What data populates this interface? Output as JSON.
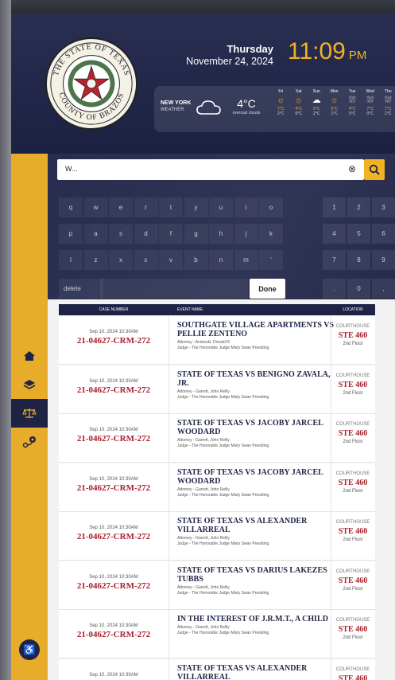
{
  "header": {
    "day": "Thursday",
    "date": "November 24, 2024",
    "time": "11:09",
    "ampm": "PM",
    "seal_text": "THE STATE OF TEXAS · COUNTY OF BRAZOS",
    "weather": {
      "city": "NEW YORK",
      "label": "WEATHER",
      "temp": "4°C",
      "desc": "overcast clouds",
      "forecast": [
        {
          "day": "Fri",
          "icon": "sun-icon",
          "hi": "7°C",
          "lo": "2°C"
        },
        {
          "day": "Sat",
          "icon": "sun-icon",
          "hi": "4°C",
          "lo": "0°C"
        },
        {
          "day": "Sun",
          "icon": "cloud-icon",
          "hi": "5°C",
          "lo": "2°C"
        },
        {
          "day": "Mon",
          "icon": "sun-icon",
          "hi": "5°C",
          "lo": "1°C"
        },
        {
          "day": "Tue",
          "icon": "rain-icon",
          "hi": "4°C",
          "lo": "0°C"
        },
        {
          "day": "Wed",
          "icon": "rain-icon",
          "hi": "7°C",
          "lo": "0°C"
        },
        {
          "day": "Thu",
          "icon": "rain-icon",
          "hi": "7°C",
          "lo": "1°C"
        }
      ]
    }
  },
  "search": {
    "value": "W..."
  },
  "keyboard": {
    "row1": [
      "q",
      "w",
      "e",
      "r",
      "t",
      "y",
      "u",
      "i",
      "o"
    ],
    "row2": [
      "p",
      "a",
      "s",
      "d",
      "f",
      "g",
      "h",
      "j",
      "k"
    ],
    "row3": [
      "l",
      "z",
      "x",
      "c",
      "v",
      "b",
      "n",
      "m",
      "'"
    ],
    "num_rows": [
      [
        "1",
        "2",
        "3"
      ],
      [
        "4",
        "5",
        "6"
      ],
      [
        "7",
        "8",
        "9"
      ],
      [
        ".",
        "0",
        ","
      ]
    ],
    "delete": "delete",
    "done": "Done"
  },
  "table": {
    "headers": {
      "case": "CASE NUMBER",
      "event": "EVENT NAME",
      "location": "LOCATION"
    },
    "rows": [
      {
        "date": "Sep 10, 2024 10:30AM",
        "case": "21-04627-CRM-272",
        "event": "SOUTHGATE VILLAGE APARTMENTS VS PELLIE ZENTENO",
        "attorney": "Attorney - Andreski, Donald R.",
        "judge": "Judge - The Honorable Judge Misty Swan Presiding",
        "building": "COURTHOUSE",
        "room": "STE 460",
        "floor": "2nd Floor"
      },
      {
        "date": "Sep 10, 2024 10:30AM",
        "case": "21-04627-CRM-272",
        "event": "STATE OF TEXAS VS BENIGNO ZAVALA, JR.",
        "attorney": "Attorney - Garrett, John Reilly",
        "judge": "Judge - The Honorable Judge Misty Swan Presiding",
        "building": "COURTHOUSE",
        "room": "STE 460",
        "floor": "2nd Floor"
      },
      {
        "date": "Sep 10, 2024 10:30AM",
        "case": "21-04627-CRM-272",
        "event": "STATE OF TEXAS VS JACOBY JARCEL WOODARD",
        "attorney": "Attorney - Garrett, John Reilly",
        "judge": "Judge - The Honorable Judge Misty Swan Presiding",
        "building": "COURTHOUSE",
        "room": "STE 460",
        "floor": "2nd Floor"
      },
      {
        "date": "Sep 10, 2024 10:30AM",
        "case": "21-04627-CRM-272",
        "event": "STATE OF TEXAS VS JACOBY JARCEL WOODARD",
        "attorney": "Attorney - Garrett, John Reilly",
        "judge": "Judge - The Honorable Judge Misty Swan Presiding",
        "building": "COURTHOUSE",
        "room": "STE 460",
        "floor": "2nd Floor"
      },
      {
        "date": "Sep 10, 2024 10:30AM",
        "case": "21-04627-CRM-272",
        "event": "STATE OF TEXAS VS ALEXANDER VILLARREAL",
        "attorney": "Attorney - Garrett, John Reilly",
        "judge": "Judge - The Honorable Judge Misty Swan Presiding",
        "building": "COURTHOUSE",
        "room": "STE 460",
        "floor": "2nd Floor"
      },
      {
        "date": "Sep 10, 2024 10:30AM",
        "case": "21-04627-CRM-272",
        "event": "STATE OF TEXAS VS DARIUS LAKEZES TUBBS",
        "attorney": "Attorney - Garrett, John Reilly",
        "judge": "Judge - The Honorable Judge Misty Swan Presiding",
        "building": "COURTHOUSE",
        "room": "STE 460",
        "floor": "2nd Floor"
      },
      {
        "date": "Sep 10, 2024 10:30AM",
        "case": "21-04627-CRM-272",
        "event": "IN THE INTEREST OF J.R.M.T., A CHILD",
        "attorney": "Attorney - Garrett, John Reilly",
        "judge": "Judge - The Honorable Judge Misty Swan Presiding",
        "building": "COURTHOUSE",
        "room": "STE 460",
        "floor": "2nd Floor"
      },
      {
        "date": "Sep 10, 2024 10:30AM",
        "case": "21-04627-CRM-272",
        "event": "STATE OF TEXAS VS ALEXANDER VILLARREAL",
        "attorney": "",
        "judge": "",
        "building": "COURTHOUSE",
        "room": "STE 460",
        "floor": ""
      }
    ]
  },
  "colors": {
    "navy": "#1f2447",
    "gold": "#f0b323",
    "crimson": "#a8202c",
    "sidebar": "#e6ac2a"
  }
}
